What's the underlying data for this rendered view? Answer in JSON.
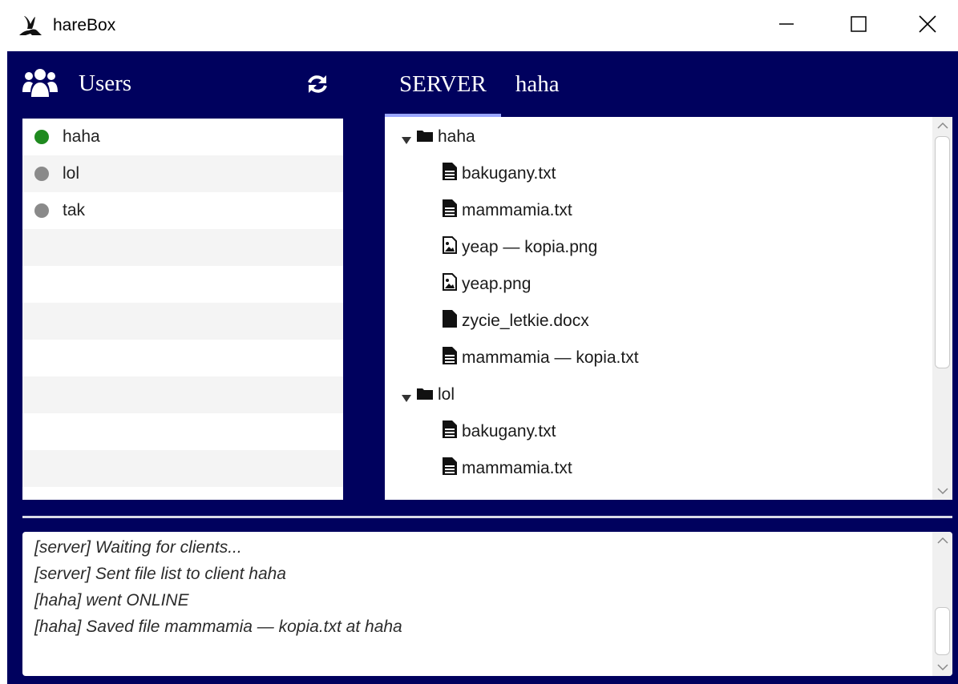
{
  "window": {
    "title": "hareBox",
    "app_icon": "hare-icon",
    "controls": [
      "minimize-icon",
      "maximize-icon",
      "close-icon"
    ]
  },
  "colors": {
    "frame": "#00015e",
    "online": "#1f8a1f",
    "offline": "#8a8a8a",
    "tab_underline": "#9aa6ff"
  },
  "users_panel": {
    "label": "Users",
    "icon": "users-icon",
    "refresh_icon": "refresh-icon",
    "users": [
      {
        "name": "haha",
        "status": "online"
      },
      {
        "name": "lol",
        "status": "offline"
      },
      {
        "name": "tak",
        "status": "offline"
      }
    ]
  },
  "tabs": [
    {
      "label": "SERVER",
      "active": true
    },
    {
      "label": "haha",
      "active": false
    }
  ],
  "file_tree": [
    {
      "type": "folder",
      "name": "haha",
      "expanded": true,
      "depth": 0
    },
    {
      "type": "text-file",
      "name": "bakugany.txt",
      "depth": 1
    },
    {
      "type": "text-file",
      "name": "mammamia.txt",
      "depth": 1
    },
    {
      "type": "image-file",
      "name": "yeap — kopia.png",
      "depth": 1
    },
    {
      "type": "image-file",
      "name": "yeap.png",
      "depth": 1
    },
    {
      "type": "file",
      "name": "zycie_letkie.docx",
      "depth": 1
    },
    {
      "type": "text-file",
      "name": "mammamia — kopia.txt",
      "depth": 1
    },
    {
      "type": "folder",
      "name": "lol",
      "expanded": true,
      "depth": 0
    },
    {
      "type": "text-file",
      "name": "bakugany.txt",
      "depth": 1
    },
    {
      "type": "text-file",
      "name": "mammamia.txt",
      "depth": 1
    }
  ],
  "log": [
    "[server] Waiting for clients...",
    "[server] Sent file list to client haha",
    "[haha] went ONLINE",
    "[haha] Saved file mammamia — kopia.txt at haha"
  ]
}
